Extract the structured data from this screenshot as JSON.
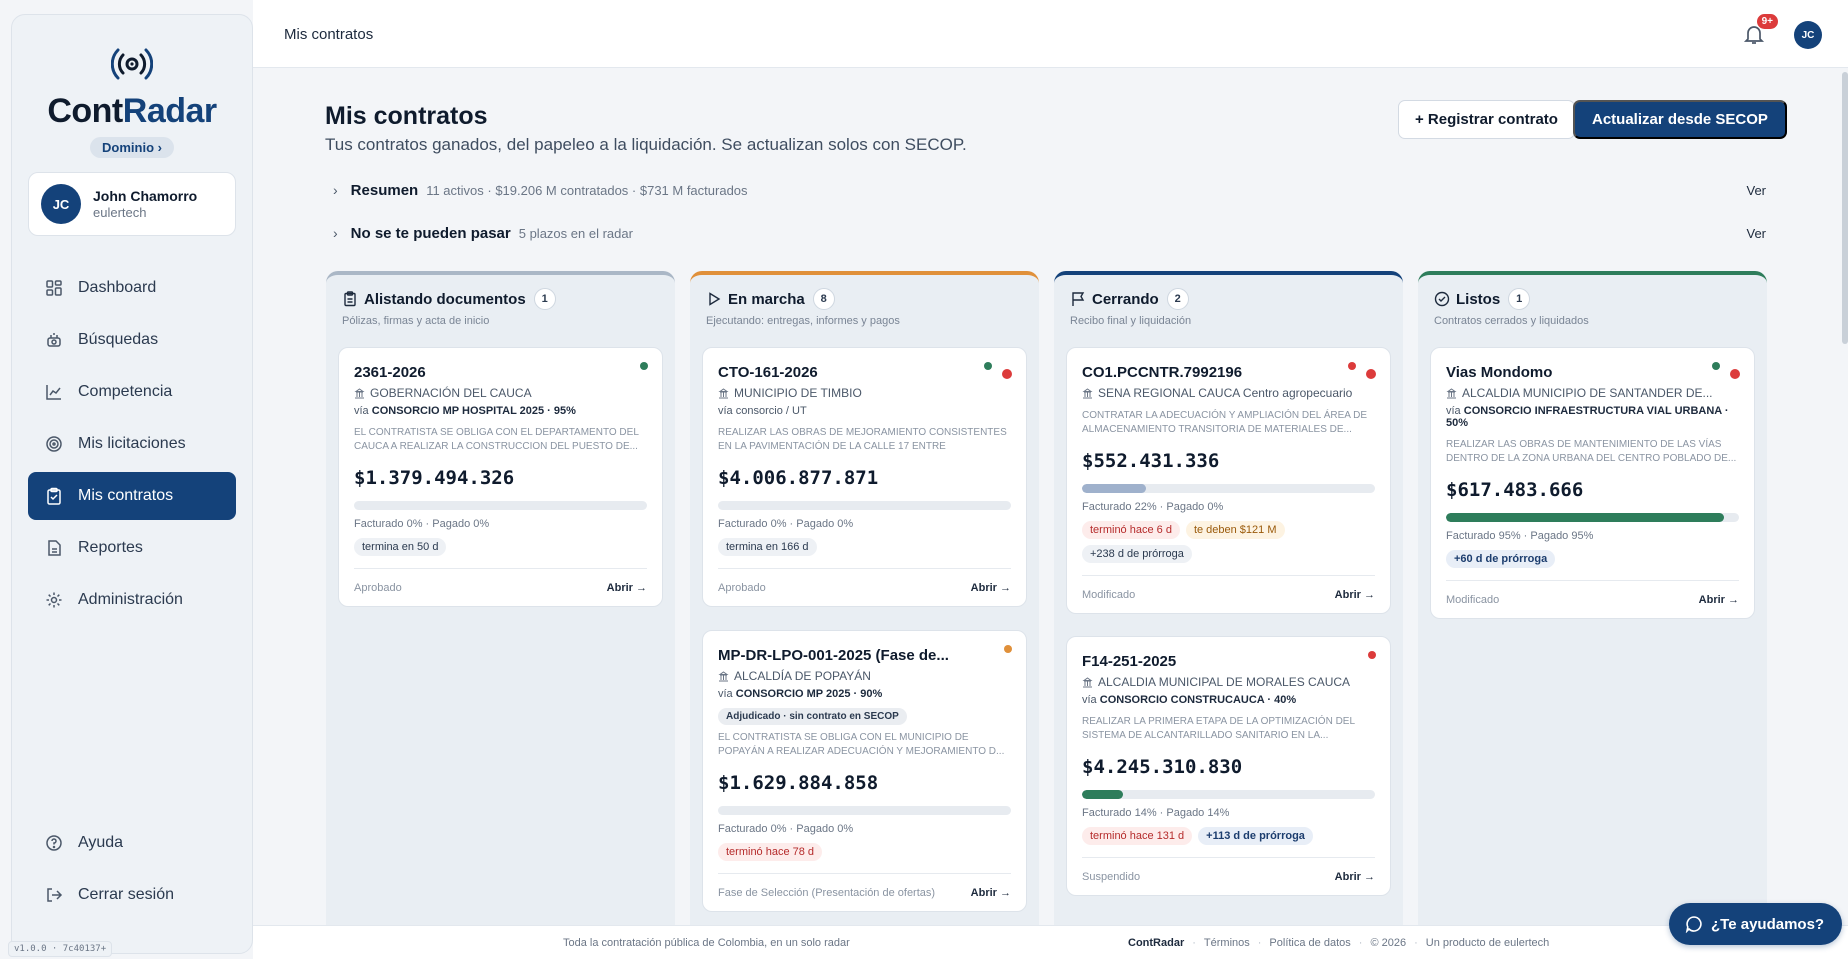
{
  "app": {
    "logo_part1": "Cont",
    "logo_part2": "Radar",
    "domain_label": "Dominio ›",
    "version": "v1.0.0 · 7c40137+"
  },
  "user": {
    "initials": "JC",
    "name": "John Chamorro",
    "org": "eulertech"
  },
  "sidebar": {
    "items": [
      {
        "label": "Dashboard",
        "icon": "grid-icon"
      },
      {
        "label": "Búsquedas",
        "icon": "radar-icon"
      },
      {
        "label": "Competencia",
        "icon": "chart-line-icon"
      },
      {
        "label": "Mis licitaciones",
        "icon": "target-icon"
      },
      {
        "label": "Mis contratos",
        "icon": "clipboard-check-icon",
        "active": true
      },
      {
        "label": "Reportes",
        "icon": "document-icon"
      },
      {
        "label": "Administración",
        "icon": "gear-icon"
      }
    ],
    "bottom": [
      {
        "label": "Ayuda",
        "icon": "help-icon"
      },
      {
        "label": "Cerrar sesión",
        "icon": "logout-icon"
      }
    ]
  },
  "topbar": {
    "title": "Mis contratos",
    "notif_badge": "9+",
    "avatar": "JC"
  },
  "main": {
    "title": "Mis contratos",
    "subtitle": "Tus contratos ganados, del papeleo a la liquidación. Se actualizan solos con SECOP.",
    "register_button": "+ Registrar contrato",
    "update_button": "Actualizar desde SECOP",
    "resumen": {
      "label": "Resumen",
      "detail": "11 activos · $19.206 M contratados · $731 M facturados",
      "action": "Ver"
    },
    "plazos": {
      "label": "No se te pueden pasar",
      "detail": "5 plazos en el radar",
      "action": "Ver"
    }
  },
  "columns": [
    {
      "title": "Alistando documentos",
      "count": "1",
      "subtitle": "Pólizas, firmas y acta de inicio",
      "accent": "#aab7c6",
      "cards": [
        {
          "title": "2361-2026",
          "entity": "GOBERNACIÓN DEL CAUCA",
          "via_prefix": "vía",
          "via": "CONSORCIO MP HOSPITAL 2025 · 95%",
          "objeto": "EL CONTRATISTA SE OBLIGA CON EL DEPARTAMENTO DEL CAUCA A REALIZAR LA CONSTRUCCION DEL PUESTO DE...",
          "amount": "$1.379.494.326",
          "progress": 0,
          "fact": "Facturado 0% · Pagado 0%",
          "chips": [
            "termina en 50 d"
          ],
          "status": "Aprobado",
          "open": "Abrir →"
        }
      ]
    },
    {
      "title": "En marcha",
      "count": "8",
      "subtitle": "Ejecutando: entregas, informes y pagos",
      "accent": "#e0903a",
      "cards": [
        {
          "title": "CTO-161-2026",
          "entity": "MUNICIPIO DE TIMBIO",
          "via_prefix": "vía",
          "via": "consorcio / UT",
          "objeto": "REALIZAR LAS OBRAS DE MEJORAMIENTO CONSISTENTES EN LA PAVIMENTACIÓN DE LA CALLE 17 ENTRE CARRERAS...",
          "amount": "$4.006.877.871",
          "progress": 0,
          "fact": "Facturado 0% · Pagado 0%",
          "chips": [
            "termina en 166 d"
          ],
          "status": "Aprobado",
          "open": "Abrir →"
        },
        {
          "title": "MP-DR-LPO-001-2025 (Fase de...",
          "entity": "ALCALDÍA DE POPAYÁN",
          "via_prefix": "vía",
          "via": "CONSORCIO MP 2025 · 90%",
          "badge": "Adjudicado · sin contrato en SECOP",
          "objeto": "EL CONTRATISTA SE OBLIGA CON EL MUNICIPIO DE POPAYÁN A REALIZAR ADECUACIÓN Y MEJORAMIENTO D...",
          "amount": "$1.629.884.858",
          "progress": 0,
          "fact": "Facturado 0% · Pagado 0%",
          "chips": [
            "terminó hace 78 d"
          ],
          "status": "Fase de Selección (Presentación de ofertas)",
          "open": "Abrir →"
        }
      ]
    },
    {
      "title": "Cerrando",
      "count": "2",
      "subtitle": "Recibo final y liquidación",
      "accent": "#14427a",
      "cards": [
        {
          "title": "CO1.PCCNTR.7992196",
          "entity": "SENA REGIONAL CAUCA Centro agropecuario",
          "via_prefix": "",
          "via": "",
          "objeto": "CONTRATAR LA ADECUACIÓN Y AMPLIACIÓN DEL ÁREA DE ALMACENAMIENTO TRANSITORIA DE MATERIALES DE...",
          "amount": "$552.431.336",
          "progress": 0.22,
          "fact": "Facturado 22% · Pagado 0%",
          "chips": [
            "terminó hace 6 d",
            "te deben $121 M",
            "+238 d de prórroga"
          ],
          "status": "Modificado",
          "open": "Abrir →"
        },
        {
          "title": "F14-251-2025",
          "entity": "ALCALDIA MUNICIPAL DE MORALES CAUCA",
          "via_prefix": "vía",
          "via": "CONSORCIO CONSTRUCAUCA · 40%",
          "objeto": "REALIZAR LA PRIMERA ETAPA DE LA OPTIMIZACIÓN DEL SISTEMA DE ALCANTARILLADO SANITARIO EN LA...",
          "amount": "$4.245.310.830",
          "progress": 0.14,
          "fact": "Facturado 14% · Pagado 14%",
          "chips": [
            "terminó hace 131 d",
            "+113 d de prórroga"
          ],
          "status": "Suspendido",
          "open": "Abrir →"
        }
      ]
    },
    {
      "title": "Listos",
      "count": "1",
      "subtitle": "Contratos cerrados y liquidados",
      "accent": "#2e7d5b",
      "cards": [
        {
          "title": "Vias Mondomo",
          "entity": "ALCALDIA MUNICIPIO DE SANTANDER DE...",
          "via_prefix": "vía",
          "via": "CONSORCIO INFRAESTRUCTURA VIAL URBANA · 50%",
          "objeto": "REALIZAR LAS OBRAS DE MANTENIMIENTO DE LAS VÍAS DENTRO DE LA ZONA URBANA DEL CENTRO POBLADO DE...",
          "amount": "$617.483.666",
          "progress": 0.95,
          "fact": "Facturado 95% · Pagado 95%",
          "chips": [
            "+60 d de prórroga"
          ],
          "status": "Modificado",
          "open": "Abrir →"
        }
      ]
    }
  ],
  "footer": {
    "tagline": "Toda la contratación pública de Colombia, en un solo radar",
    "brand": "ContRadar",
    "terms": "Términos",
    "privacy": "Política de datos",
    "year": "© 2026",
    "product": "Un producto de eulertech"
  },
  "help_button": "¿Te ayudamos?",
  "colors": {
    "primary": "#14427a",
    "danger": "#dc3b3b",
    "success": "#2e7d5b",
    "warning": "#e0903a"
  }
}
